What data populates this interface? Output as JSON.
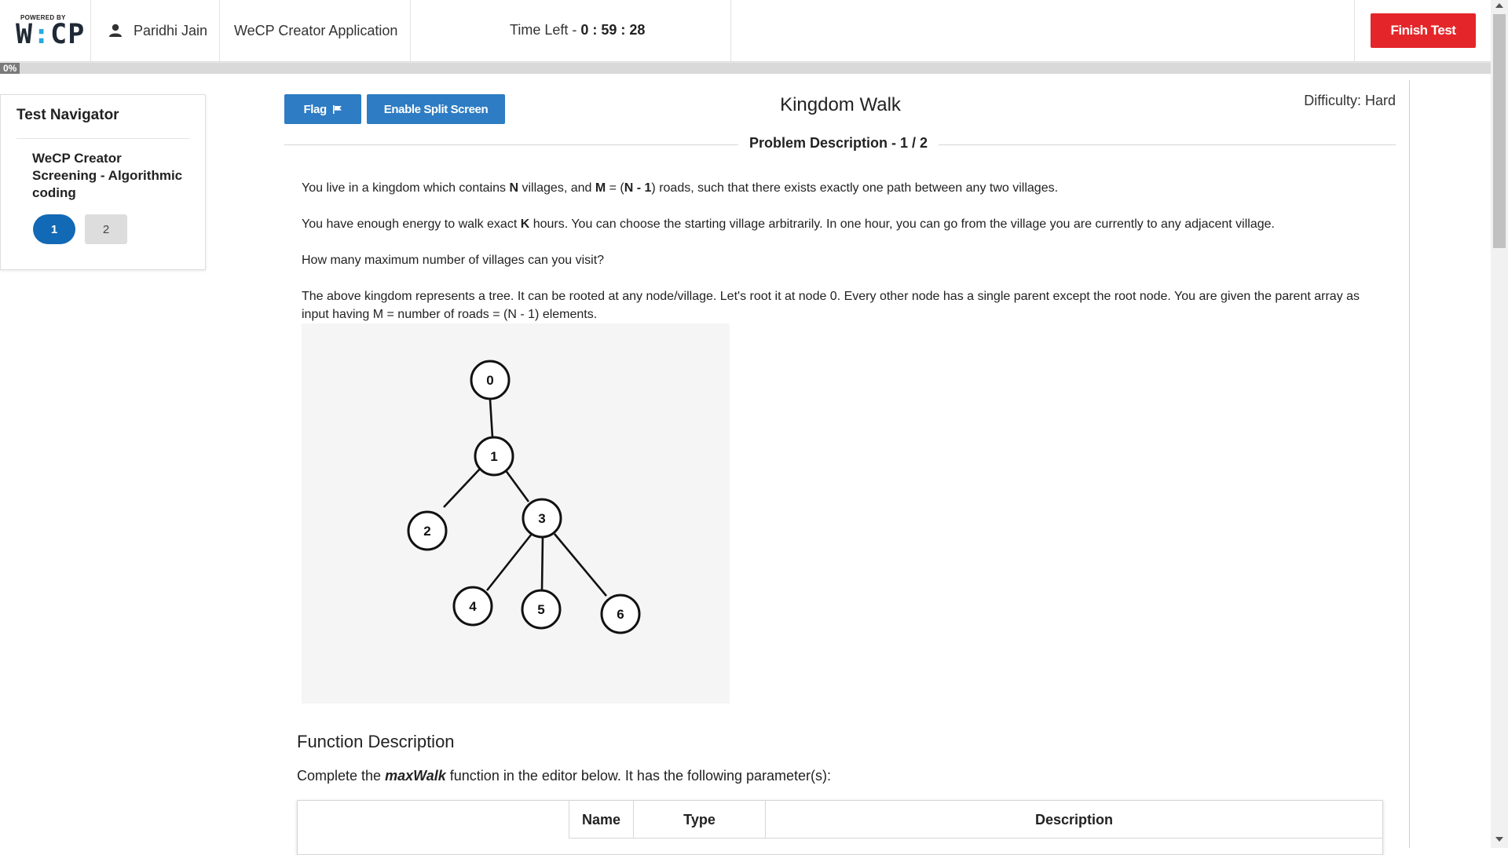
{
  "header": {
    "powered_by": "POWERED BY",
    "logo_left": "W",
    "logo_dots": ":",
    "logo_right": "CP",
    "user_name": "Paridhi Jain",
    "app_name": "WeCP Creator Application",
    "time_label": "Time Left - ",
    "time_value": "0 : 59 : 28",
    "finish_label": "Finish Test"
  },
  "progress": {
    "label": "0%",
    "value": 0
  },
  "navigator": {
    "title": "Test Navigator",
    "section": "WeCP Creator Screening - Algorithmic coding",
    "questions": [
      "1",
      "2"
    ]
  },
  "toolbar": {
    "flag_label": "Flag",
    "split_label": "Enable Split Screen"
  },
  "problem": {
    "title": "Kingdom Walk",
    "difficulty": "Difficulty: Hard",
    "section_heading": "Problem Description - 1 / 2",
    "p1": {
      "a": "You live in a kingdom which contains ",
      "b": "N",
      "c": " villages, and ",
      "d": "M",
      "e": " = (",
      "f": "N - 1",
      "g": ") roads, such that there exists exactly one path between any two villages."
    },
    "p2": {
      "a": "You have enough energy to walk exact ",
      "b": "K",
      "c": " hours. You can choose the starting village arbitrarily. In one hour, you can go from the village you are currently to any adjacent village."
    },
    "p3": "How many maximum number of villages can you visit?",
    "p4": "The above kingdom represents a tree. It can be rooted at any node/village. Let's root it at node 0. Every other node has a single parent except the root node. You are given the parent array as input having M = number of roads = (N - 1) elements.",
    "tree_nodes": [
      "0",
      "1",
      "2",
      "3",
      "4",
      "5",
      "6"
    ]
  },
  "function_description": {
    "title": "Function Description",
    "text_a": "Complete the ",
    "func_name": "maxWalk",
    "text_b": " function in the editor below. It has the following parameter(s):",
    "columns": [
      "Name",
      "Type",
      "Description"
    ]
  },
  "colors": {
    "finish": "#e4262a",
    "primary_button": "#2e7cc3",
    "active_question": "#1269b5",
    "logo_accent": "#29a9e1"
  }
}
